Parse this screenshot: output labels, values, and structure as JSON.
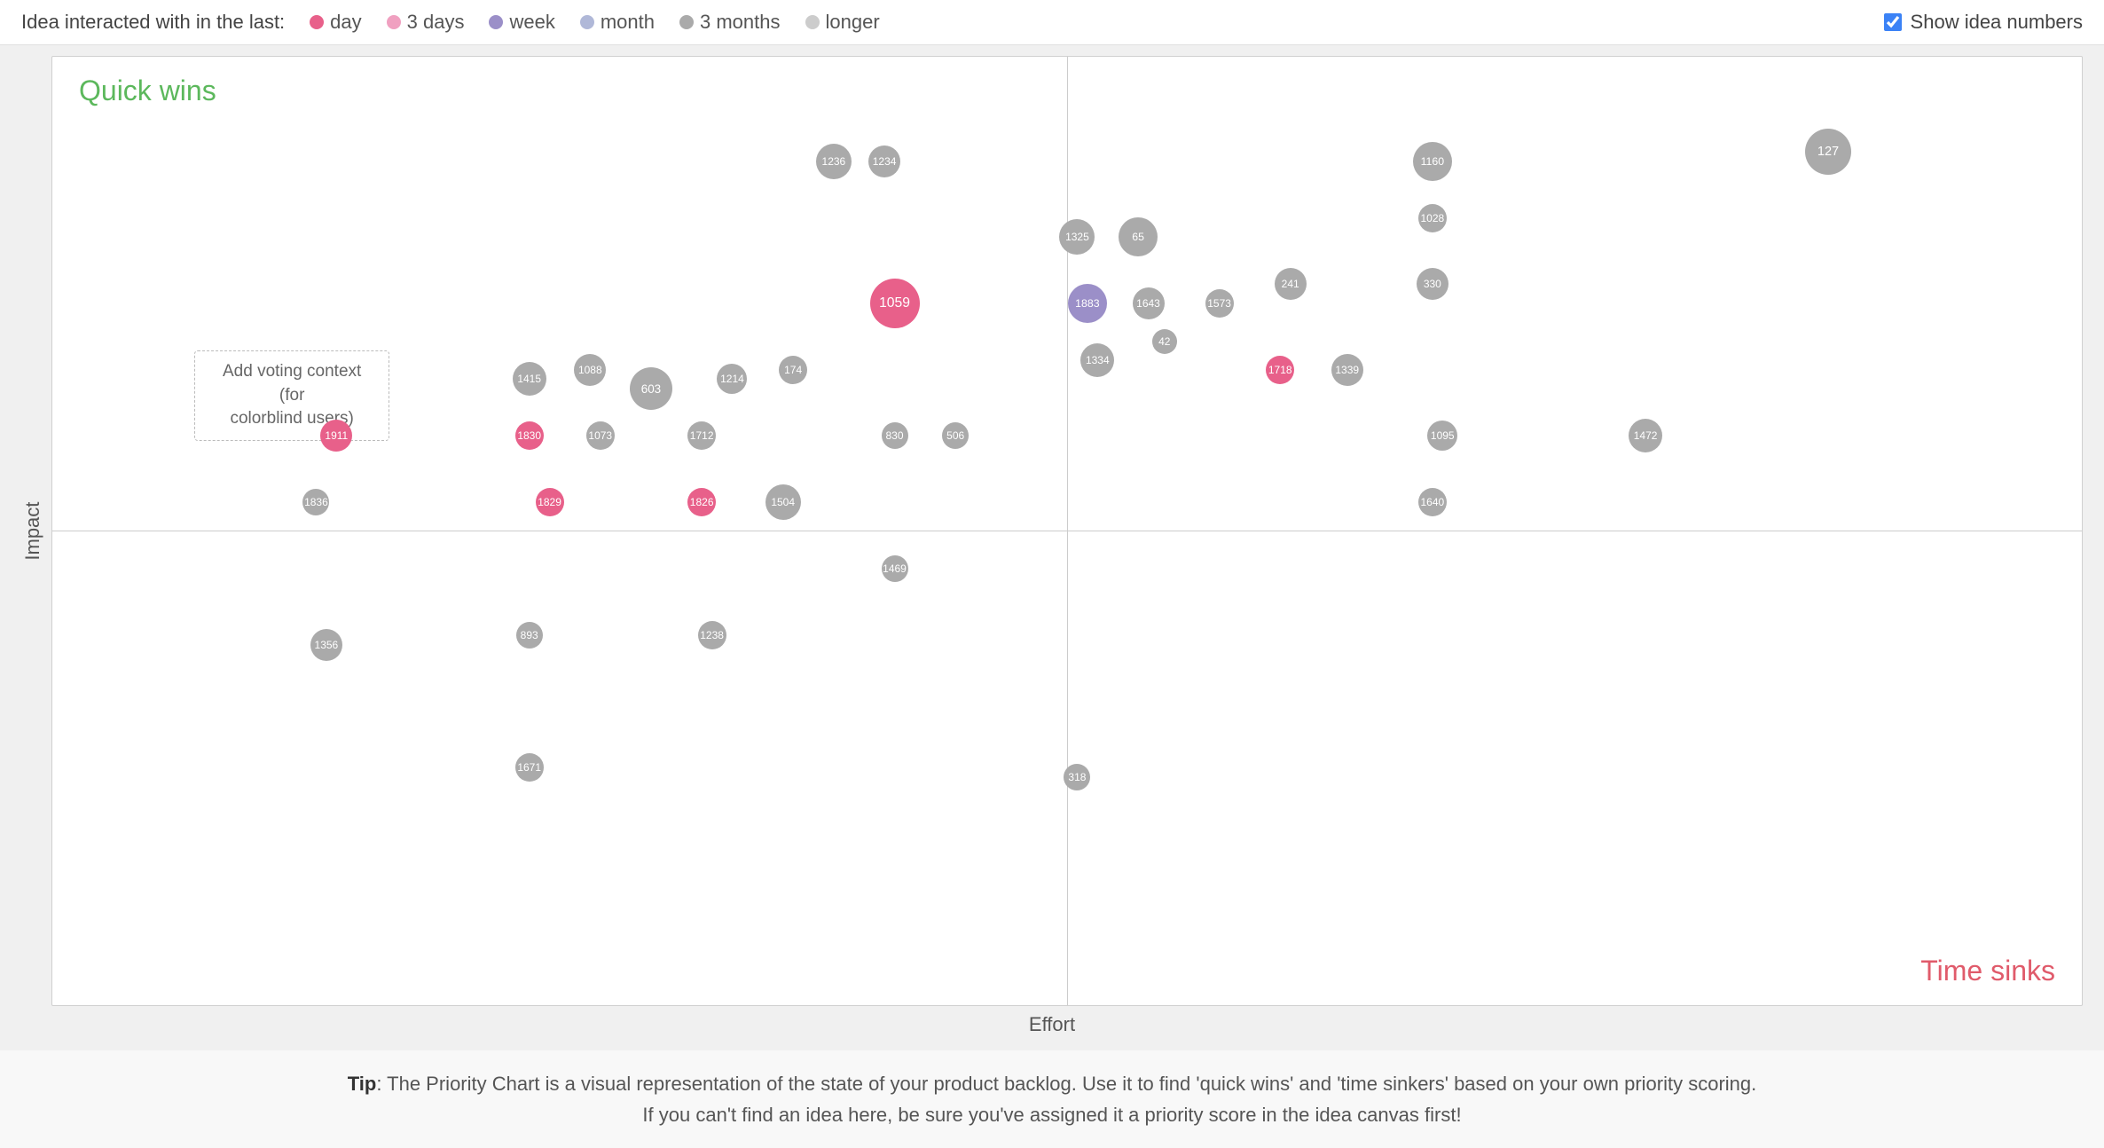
{
  "legend": {
    "title": "Idea interacted with in the last:",
    "items": [
      {
        "label": "day",
        "color": "#e8608a",
        "id": "day"
      },
      {
        "label": "3 days",
        "color": "#f0a0c0",
        "id": "3days"
      },
      {
        "label": "week",
        "color": "#9b8fc8",
        "id": "week"
      },
      {
        "label": "month",
        "color": "#b0b8d8",
        "id": "month"
      },
      {
        "label": "3 months",
        "color": "#aaaaaa",
        "id": "3months"
      },
      {
        "label": "longer",
        "color": "#cccccc",
        "id": "longer"
      }
    ],
    "show_idea_numbers_label": "Show idea numbers",
    "show_idea_numbers_checked": true
  },
  "chart": {
    "quadrant_tl": "Quick wins",
    "quadrant_br": "Time sinks",
    "x_axis_label": "Effort",
    "y_axis_label": "Impact",
    "annotation": "Add voting context (for\ncolorblind users)",
    "bubbles": [
      {
        "id": "1236",
        "label": "1236",
        "x": 38.5,
        "y": 11,
        "size": 40,
        "color": "gray"
      },
      {
        "id": "1234",
        "label": "1234",
        "x": 41.0,
        "y": 11,
        "size": 36,
        "color": "gray"
      },
      {
        "id": "1160",
        "label": "1160",
        "x": 68.0,
        "y": 11,
        "size": 44,
        "color": "gray"
      },
      {
        "id": "127",
        "label": "127",
        "x": 87.5,
        "y": 10,
        "size": 52,
        "color": "gray"
      },
      {
        "id": "1028",
        "label": "1028",
        "x": 68.0,
        "y": 17,
        "size": 32,
        "color": "gray"
      },
      {
        "id": "1325",
        "label": "1325",
        "x": 50.5,
        "y": 19,
        "size": 40,
        "color": "gray"
      },
      {
        "id": "65",
        "label": "65",
        "x": 53.5,
        "y": 19,
        "size": 44,
        "color": "gray"
      },
      {
        "id": "330",
        "label": "330",
        "x": 68.0,
        "y": 24,
        "size": 36,
        "color": "gray"
      },
      {
        "id": "1883",
        "label": "1883",
        "x": 51.0,
        "y": 26,
        "size": 44,
        "color": "purple"
      },
      {
        "id": "1643",
        "label": "1643",
        "x": 54.0,
        "y": 26,
        "size": 36,
        "color": "gray"
      },
      {
        "id": "1573",
        "label": "1573",
        "x": 57.5,
        "y": 26,
        "size": 32,
        "color": "gray"
      },
      {
        "id": "241",
        "label": "241",
        "x": 61.0,
        "y": 24,
        "size": 36,
        "color": "gray"
      },
      {
        "id": "1059",
        "label": "1059",
        "x": 41.5,
        "y": 26,
        "size": 56,
        "color": "pink"
      },
      {
        "id": "1334",
        "label": "1334",
        "x": 51.5,
        "y": 32,
        "size": 38,
        "color": "gray"
      },
      {
        "id": "42",
        "label": "42",
        "x": 54.8,
        "y": 30,
        "size": 28,
        "color": "gray"
      },
      {
        "id": "1718",
        "label": "1718",
        "x": 60.5,
        "y": 33,
        "size": 32,
        "color": "pink"
      },
      {
        "id": "1339",
        "label": "1339",
        "x": 63.8,
        "y": 33,
        "size": 36,
        "color": "gray"
      },
      {
        "id": "1415",
        "label": "1415",
        "x": 23.5,
        "y": 34,
        "size": 38,
        "color": "gray"
      },
      {
        "id": "1088",
        "label": "1088",
        "x": 26.5,
        "y": 33,
        "size": 36,
        "color": "gray"
      },
      {
        "id": "603",
        "label": "603",
        "x": 29.5,
        "y": 35,
        "size": 48,
        "color": "gray"
      },
      {
        "id": "1214",
        "label": "1214",
        "x": 33.5,
        "y": 34,
        "size": 34,
        "color": "gray"
      },
      {
        "id": "174",
        "label": "174",
        "x": 36.5,
        "y": 33,
        "size": 32,
        "color": "gray"
      },
      {
        "id": "1095",
        "label": "1095",
        "x": 68.5,
        "y": 40,
        "size": 34,
        "color": "gray"
      },
      {
        "id": "1472",
        "label": "1472",
        "x": 78.5,
        "y": 40,
        "size": 38,
        "color": "gray"
      },
      {
        "id": "1830",
        "label": "1830",
        "x": 23.5,
        "y": 40,
        "size": 32,
        "color": "pink"
      },
      {
        "id": "1073",
        "label": "1073",
        "x": 27.0,
        "y": 40,
        "size": 32,
        "color": "gray"
      },
      {
        "id": "1712",
        "label": "1712",
        "x": 32.0,
        "y": 40,
        "size": 32,
        "color": "gray"
      },
      {
        "id": "830",
        "label": "830",
        "x": 41.5,
        "y": 40,
        "size": 30,
        "color": "gray"
      },
      {
        "id": "506",
        "label": "506",
        "x": 44.5,
        "y": 40,
        "size": 30,
        "color": "gray"
      },
      {
        "id": "1911",
        "label": "1911",
        "x": 14.0,
        "y": 40,
        "size": 36,
        "color": "pink"
      },
      {
        "id": "1836",
        "label": "1836",
        "x": 13.0,
        "y": 47,
        "size": 30,
        "color": "gray"
      },
      {
        "id": "1829",
        "label": "1829",
        "x": 24.5,
        "y": 47,
        "size": 32,
        "color": "pink"
      },
      {
        "id": "1826",
        "label": "1826",
        "x": 32.0,
        "y": 47,
        "size": 32,
        "color": "pink"
      },
      {
        "id": "1504",
        "label": "1504",
        "x": 36.0,
        "y": 47,
        "size": 40,
        "color": "gray"
      },
      {
        "id": "1640",
        "label": "1640",
        "x": 68.0,
        "y": 47,
        "size": 32,
        "color": "gray"
      },
      {
        "id": "1469",
        "label": "1469",
        "x": 41.5,
        "y": 54,
        "size": 30,
        "color": "gray"
      },
      {
        "id": "1356",
        "label": "1356",
        "x": 13.5,
        "y": 62,
        "size": 36,
        "color": "gray"
      },
      {
        "id": "893",
        "label": "893",
        "x": 23.5,
        "y": 61,
        "size": 30,
        "color": "gray"
      },
      {
        "id": "1238",
        "label": "1238",
        "x": 32.5,
        "y": 61,
        "size": 32,
        "color": "gray"
      },
      {
        "id": "1671",
        "label": "1671",
        "x": 23.5,
        "y": 75,
        "size": 32,
        "color": "gray"
      },
      {
        "id": "318",
        "label": "318",
        "x": 50.5,
        "y": 76,
        "size": 30,
        "color": "gray"
      }
    ]
  },
  "tip": {
    "bold": "Tip",
    "text": ": The Priority Chart is a visual representation of the state of your product backlog. Use it to find 'quick wins' and 'time sinkers' based on your own priority scoring.\nIf you can't find an idea here, be sure you've assigned it a priority score in the idea canvas first!"
  }
}
